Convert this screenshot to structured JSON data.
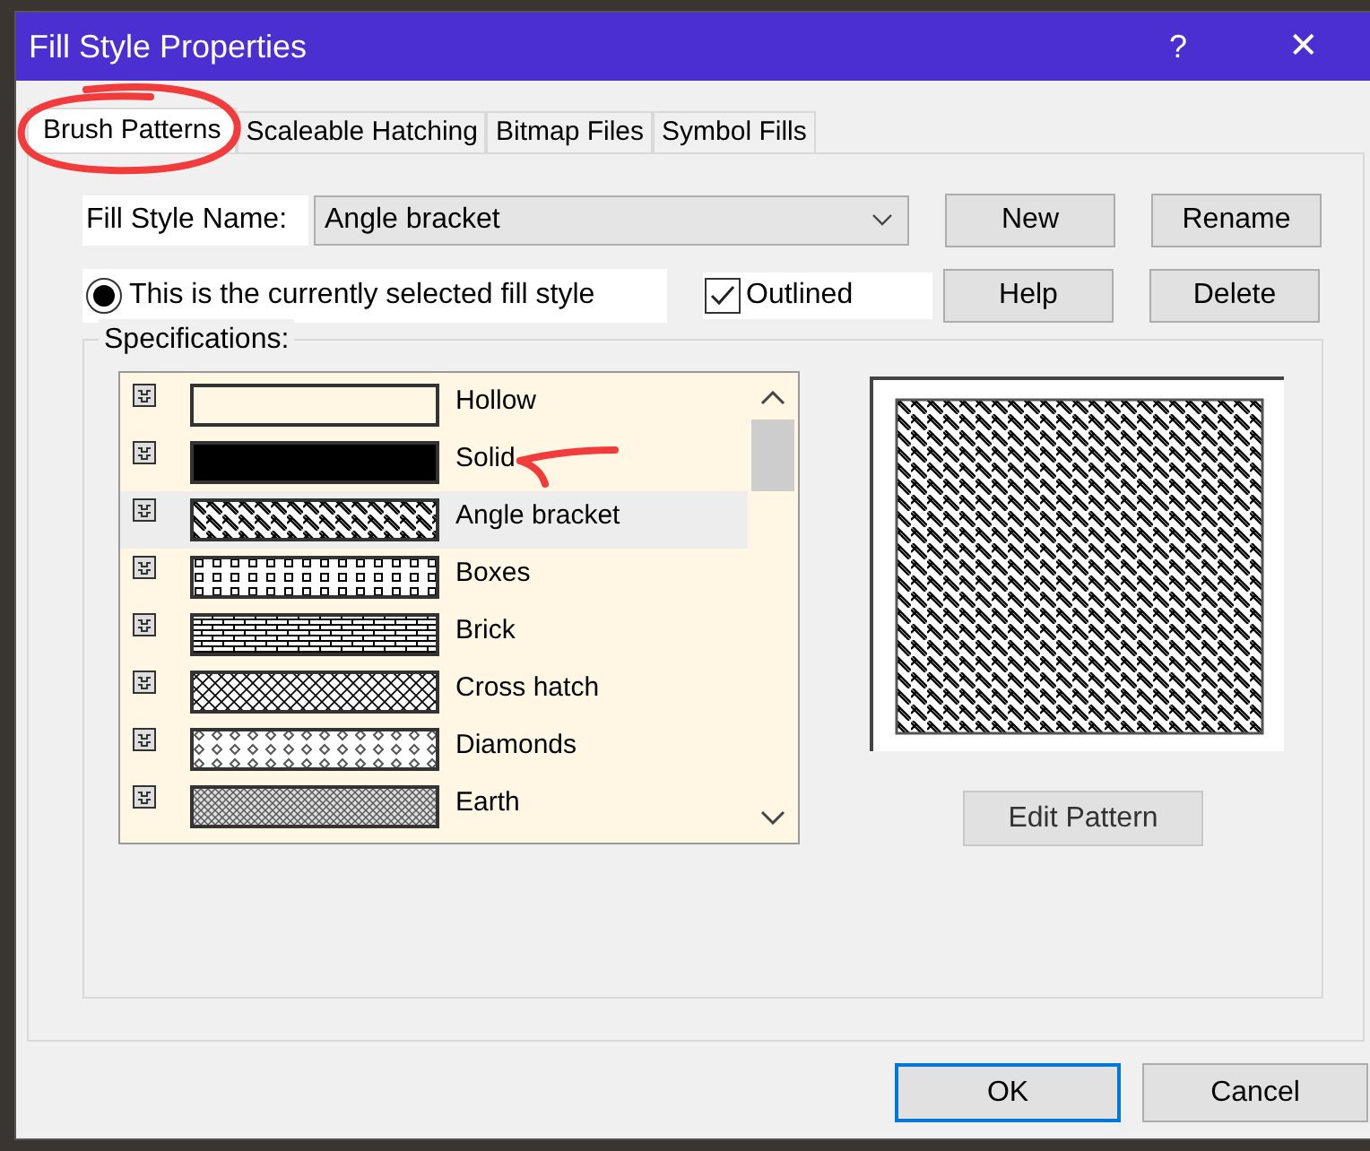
{
  "window": {
    "title": "Fill Style Properties",
    "help_button": "?",
    "close_button": "✕"
  },
  "tabs": [
    {
      "label": "Brush Patterns",
      "selected": true
    },
    {
      "label": "Scaleable Hatching",
      "selected": false
    },
    {
      "label": "Bitmap Files",
      "selected": false
    },
    {
      "label": "Symbol Fills",
      "selected": false
    }
  ],
  "fill_style_name": {
    "label": "Fill Style Name:",
    "value": "Angle bracket"
  },
  "current_style": {
    "label": "This is the currently selected fill style",
    "selected": true
  },
  "outlined": {
    "label": "Outlined",
    "checked": true
  },
  "side_buttons": [
    "New",
    "Rename",
    "Help",
    "Delete"
  ],
  "specifications": {
    "label": "Specifications:",
    "patterns": [
      {
        "name": "Hollow",
        "kind": "hollow",
        "selected": false
      },
      {
        "name": "Solid",
        "kind": "solid",
        "selected": false
      },
      {
        "name": "Angle bracket",
        "kind": "angle",
        "selected": true
      },
      {
        "name": "Boxes",
        "kind": "boxes",
        "selected": false
      },
      {
        "name": "Brick",
        "kind": "brick",
        "selected": false
      },
      {
        "name": "Cross hatch",
        "kind": "crosshatch",
        "selected": false
      },
      {
        "name": "Diamonds",
        "kind": "diamonds",
        "selected": false
      },
      {
        "name": "Earth",
        "kind": "earth",
        "selected": false
      }
    ],
    "edit_button": "Edit Pattern"
  },
  "footer_buttons": [
    {
      "label": "OK",
      "default": true
    },
    {
      "label": "Cancel",
      "default": false
    }
  ]
}
